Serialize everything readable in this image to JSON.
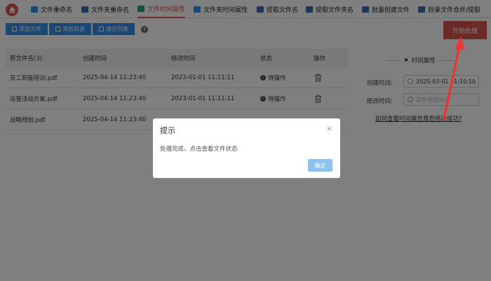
{
  "nav": {
    "tabs": [
      {
        "label": "文件重命名",
        "icon": "rename-icon",
        "color": "#3a8ee6"
      },
      {
        "label": "文件夹重命名",
        "icon": "folder-rename-icon",
        "color": "#3a6fb5"
      },
      {
        "label": "文件时间属性",
        "icon": "file-time-icon",
        "color": "#d9544f",
        "active": true
      },
      {
        "label": "文件夹时间属性",
        "icon": "folder-time-icon",
        "color": "#3a8ee6"
      },
      {
        "label": "提取文件名",
        "icon": "extract-filename-icon",
        "color": "#3a6fb5"
      },
      {
        "label": "提取文件夹名",
        "icon": "extract-foldername-icon",
        "color": "#3a6fb5"
      },
      {
        "label": "批量创建文件",
        "icon": "batch-create-icon",
        "color": "#3a6fb5"
      },
      {
        "label": "目录文件合并/提取",
        "icon": "merge-icon",
        "color": "#3a6fb5"
      }
    ]
  },
  "toolbar": {
    "add_file": "添加文件",
    "add_dir": "添加目录",
    "clear_list": "清空列表",
    "help": "?",
    "start": "开始处理"
  },
  "table": {
    "headers": {
      "name": "原文件名(3)",
      "created": "创建时间",
      "modified": "修改时间",
      "status": "状态",
      "action": "操作"
    },
    "rows": [
      {
        "name": "员工职能培训.pdf",
        "created": "2025-04-14 11:23:40",
        "modified": "2023-01-01 11:11:11",
        "status": "待操作"
      },
      {
        "name": "运营活动方案.pdf",
        "created": "2025-04-14 11:23:40",
        "modified": "2023-01-01 11:11:11",
        "status": "待操作"
      },
      {
        "name": "战略规划.pdf",
        "created": "2025-04-14 11:23:40",
        "modified": "",
        "status": ""
      }
    ]
  },
  "panel": {
    "title": "时间属性",
    "created_label": "创建时间:",
    "created_value": "2025-03-01 11:10:10",
    "modified_label": "修改时间:",
    "modified_placeholder": "文件修改时间",
    "link": "如何查看时间属性是否修改成功?"
  },
  "dialog": {
    "title": "提示",
    "close": "×",
    "message": "处理完成，点击查看文件状态",
    "ok": "确定"
  },
  "colors": {
    "accent": "#d9544f",
    "primary": "#3a8ee6"
  }
}
